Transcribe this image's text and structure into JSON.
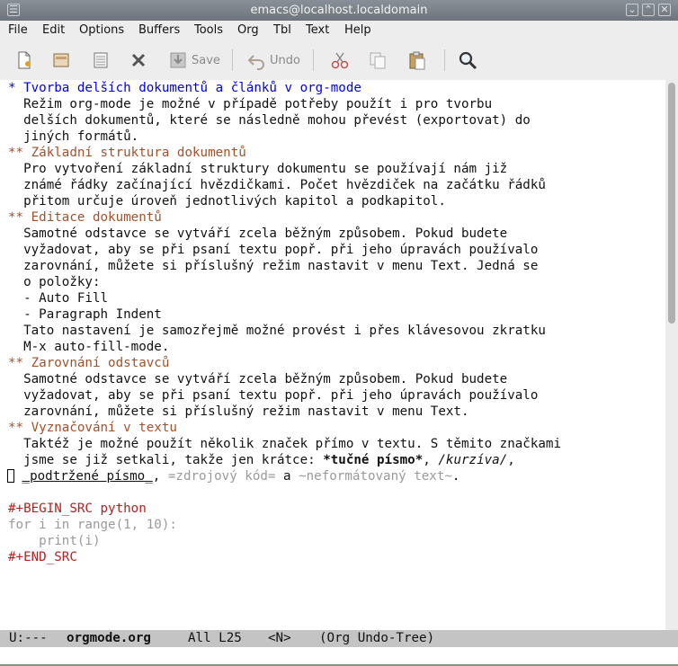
{
  "window": {
    "title": "emacs@localhost.localdomain",
    "menu_glyph": "☰",
    "minimize_glyph": "⌄",
    "maximize_glyph": "⌃",
    "close_glyph": "✕"
  },
  "menu": [
    "File",
    "Edit",
    "Options",
    "Buffers",
    "Tools",
    "Org",
    "Tbl",
    "Text",
    "Help"
  ],
  "toolbar": {
    "save_label": "Save",
    "undo_label": "Undo"
  },
  "buffer": {
    "l1": "* Tvorba delších dokumentů a článků v org-mode",
    "l2": "  Režim org-mode je možné v případě potřeby použít i pro tvorbu",
    "l3": "  delších dokumentů, které se následně mohou převést (exportovat) do",
    "l4": "  jiných formátů.",
    "l5": "** Základní struktura dokumentů",
    "l6": "  Pro vytvoření základní struktury dokumentu se používají nám již",
    "l7": "  známé řádky začínající hvězdičkami. Počet hvězdiček na začátku řádků",
    "l8": "  přitom určuje úroveň jednotlivých kapitol a podkapitol.",
    "l9": "** Editace dokumentů",
    "l10": "  Samotné odstavce se vytváří zcela běžným způsobem. Pokud budete",
    "l11": "  vyžadovat, aby se při psaní textu popř. při jeho úpravách používalo",
    "l12": "  zarovnání, můžete si příslušný režim nastavit v menu Text. Jedná se",
    "l13": "  o položky:",
    "l14": "  - Auto Fill",
    "l15": "  - Paragraph Indent",
    "l16": "  Tato nastavení je samozřejmě možné provést i přes klávesovou zkratku",
    "l17": "  M-x auto-fill-mode.",
    "l18": "** Zarovnání odstavců",
    "l19": "  Samotné odstavce se vytváří zcela běžným způsobem. Pokud budete",
    "l20": "  vyžadovat, aby se při psaní textu popř. při jeho úpravách používalo",
    "l21": "  zarovnání, můžete si příslušný režim nastavit v menu Text.",
    "l22": "** Vyznačování v textu",
    "l23": "  Taktéž je možné použít několik značek přímo v textu. S těmito značkami",
    "l24a": "  jsme se již setkali, takže jen krátce: ",
    "l24b": "*tučné písmo*",
    "l24c": ", ",
    "l24d": "/kurzíva/",
    "l24e": ",",
    "l25a": " ",
    "l25b": "_podtržené písmo_",
    "l25c": ", ",
    "l25d": "=zdrojový kód=",
    "l25e": " a ",
    "l25f": "~neformátovaný text~",
    "l25g": ".",
    "l27": "#+BEGIN_SRC python",
    "l28": "for i in range(1, 10):",
    "l29": "    print(i)",
    "l30": "#+END_SRC"
  },
  "modeline": {
    "status": "U:---",
    "buffer": "orgmode.org",
    "position": "All L25",
    "narrow": "<N>",
    "modes": "(Org Undo-Tree)"
  }
}
